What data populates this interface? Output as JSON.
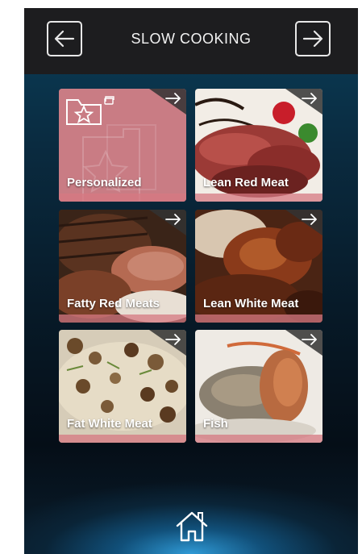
{
  "header": {
    "title": "SLOW COOKING",
    "back_icon": "arrow-left-icon",
    "forward_icon": "arrow-right-icon"
  },
  "tiles": [
    {
      "label": "Personalized",
      "icon": "folder-star-icon"
    },
    {
      "label": "Lean Red Meat"
    },
    {
      "label": "Fatty Red Meats"
    },
    {
      "label": "Lean White Meat"
    },
    {
      "label": "Fat White Meat"
    },
    {
      "label": "Fish"
    }
  ],
  "footer": {
    "home_icon": "home-icon"
  },
  "colors": {
    "topbar": "#1d1d1f",
    "personalized_tile": "#c97c84",
    "accent_strip": "#d67882"
  }
}
